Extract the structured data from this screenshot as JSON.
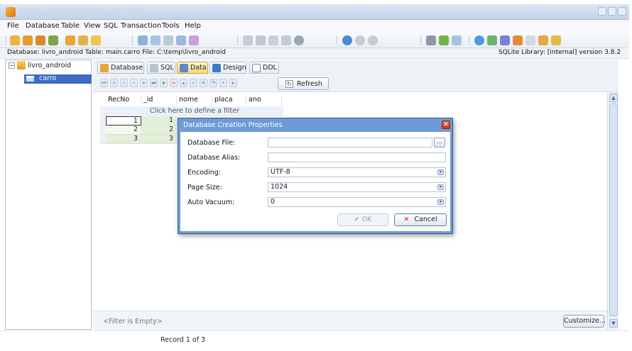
{
  "window": {
    "title": "SQLite Expert Personal 3.5.0.2428"
  },
  "menu": [
    "File",
    "Database",
    "Table",
    "View",
    "SQL",
    "Transaction",
    "Tools",
    "Help"
  ],
  "infobar": {
    "path": "Database: livro_android  Table: main.carro  File: C:\\temp\\livro_android",
    "library": "SQLite Library: [internal] version 3.8.2"
  },
  "tree": {
    "database": "livro_android",
    "table": "carro"
  },
  "tabs": [
    "Database",
    "SQL",
    "Data",
    "Design",
    "DDL"
  ],
  "refresh_label": "Refresh",
  "grid": {
    "columns": [
      "RecNo",
      "_id",
      "nome",
      "placa",
      "ano"
    ],
    "filter_hint": "Click here to define a filter",
    "rows": [
      {
        "recno": "1",
        "id": "1"
      },
      {
        "recno": "2",
        "id": "2"
      },
      {
        "recno": "3",
        "id": "3"
      }
    ]
  },
  "footer": {
    "filter_empty": "<Filter is Empty>",
    "customize_label": "Customize..."
  },
  "status": "Record 1 of 3",
  "dialog": {
    "title": "Database Creation Properties",
    "close": "✕",
    "fields": {
      "file_label": "Database File:",
      "file_value": "",
      "alias_label": "Database Alias:",
      "alias_value": "",
      "encoding_label": "Encoding:",
      "encoding_value": "UTF-8",
      "pagesize_label": "Page Size:",
      "pagesize_value": "1024",
      "vacuum_label": "Auto Vacuum:",
      "vacuum_value": "0"
    },
    "ok_label": "OK",
    "cancel_label": "Cancel"
  },
  "colors": {
    "accent": "#3d6cc2",
    "dialog_title_bg": "#6e9bd6",
    "active_tab": "#f6d977"
  },
  "icons": {
    "browse": "...",
    "dropdown": "▾",
    "check": "✔",
    "cancel": "✕"
  }
}
